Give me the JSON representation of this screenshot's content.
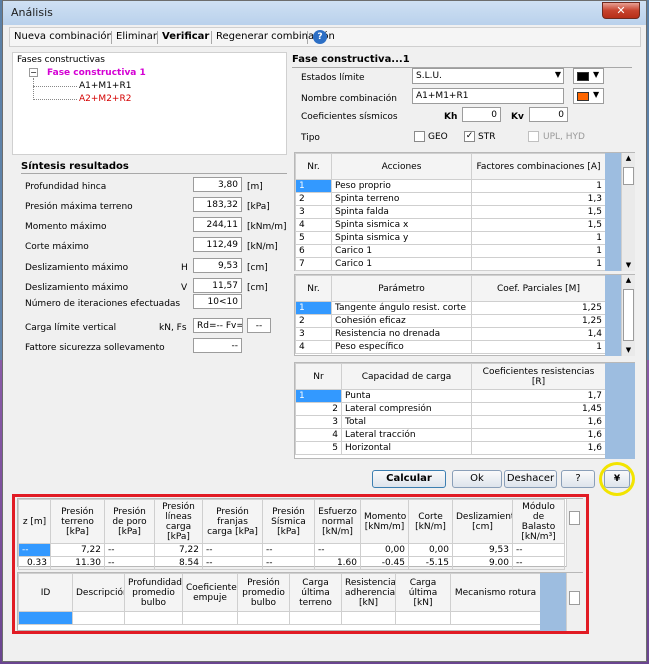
{
  "window": {
    "title": "Análisis",
    "close_label": "✕"
  },
  "toolbar": {
    "items": [
      "Nueva combinación",
      "Eliminar",
      "Verificar",
      "Regenerar combinación"
    ]
  },
  "tree": {
    "header": "Fases constructivas",
    "root": "Fase constructiva 1",
    "children": [
      {
        "label": "A1+M1+R1",
        "color": "#000000"
      },
      {
        "label": "A2+M2+R2",
        "color": "#d40000"
      }
    ]
  },
  "synth": {
    "title": "Síntesis resultados",
    "rows": [
      {
        "label": "Profundidad  hinca",
        "prefix": "",
        "value": "3,80",
        "unit": "[m]"
      },
      {
        "label": "Presión máxima terreno",
        "prefix": "",
        "value": "183,32",
        "unit": "[kPa]"
      },
      {
        "label": "Momento máximo",
        "prefix": "",
        "value": "244,11",
        "unit": "[kNm/m]"
      },
      {
        "label": "Corte máximo",
        "prefix": "",
        "value": "112,49",
        "unit": "[kN/m]"
      },
      {
        "label": "Deslizamiento máximo",
        "prefix": "H",
        "value": "9,53",
        "unit": "[cm]"
      },
      {
        "label": "Deslizamiento máximo",
        "prefix": "V",
        "value": "11,57",
        "unit": "[cm]"
      },
      {
        "label": "Número de iteraciones efectuadas",
        "prefix": "",
        "value": "10<10",
        "unit": ""
      },
      {
        "label": "Carga límite vertical",
        "prefix": "kN, Fs",
        "value": "Rd=-- Fv=--",
        "unit": "--"
      },
      {
        "label": "Fattore sicurezza sollevamento",
        "prefix": "",
        "value": "--",
        "unit": ""
      }
    ]
  },
  "phase": {
    "title": "Fase constructiva...1",
    "estados_label": "Estados límite",
    "estados_value": "S.L.U.",
    "nombre_label": "Nombre combinación",
    "nombre_value": "A1+M1+R1",
    "coef_label": "Coeficientes sísmicos",
    "kh_label": "Kh",
    "kh_value": "0",
    "kv_label": "Kv",
    "kv_value": "0",
    "tipo_label": "Tipo",
    "tipo_options": [
      {
        "label": "GEO",
        "checked": false,
        "disabled": false
      },
      {
        "label": "STR",
        "checked": true,
        "disabled": false
      },
      {
        "label": "UPL, HYD",
        "checked": false,
        "disabled": true
      }
    ],
    "color1": "#000000",
    "color2": "#ff6600"
  },
  "acciones": {
    "headers": [
      "Nr.",
      "Acciones",
      "Factores combinaciones [A]"
    ],
    "rows": [
      [
        "1",
        "Peso proprio",
        "1"
      ],
      [
        "2",
        "Spinta terreno",
        "1,3"
      ],
      [
        "3",
        "Spinta falda",
        "1,5"
      ],
      [
        "4",
        "Spinta sismica x",
        "1,5"
      ],
      [
        "5",
        "Spinta sismica y",
        "1"
      ],
      [
        "6",
        "Carico 1",
        "1"
      ],
      [
        "7",
        "Carico 1",
        "1"
      ]
    ]
  },
  "parametros": {
    "headers": [
      "Nr.",
      "Parámetro",
      "Coef. Parciales [M]"
    ],
    "rows": [
      [
        "1",
        "Tangente ángulo resist. corte",
        "1,25"
      ],
      [
        "2",
        "Cohesión eficaz",
        "1,25"
      ],
      [
        "3",
        "Resistencia no drenada",
        "1,4"
      ],
      [
        "4",
        "Peso específico",
        "1"
      ]
    ]
  },
  "capacidad": {
    "headers": [
      "Nr",
      "Capacidad de carga",
      "Coeficientes resistencias [R]"
    ],
    "rows": [
      [
        "1",
        "Punta",
        "1,7"
      ],
      [
        "2",
        "Lateral compresión",
        "1,45"
      ],
      [
        "3",
        "Total",
        "1,6"
      ],
      [
        "4",
        "Lateral tracción",
        "1,6"
      ],
      [
        "5",
        "Horizontal",
        "1,6"
      ]
    ]
  },
  "buttons": {
    "calcular": "Calcular",
    "ok": "Ok",
    "deshacer": "Deshacer",
    "help": "?",
    "expand": "¥"
  },
  "results": {
    "headers": [
      "z [m]",
      "Presión terreno [kPa]",
      "Presión de poro [kPa]",
      "Presión líneas carga [kPa]",
      "Presión franjas carga [kPa]",
      "Presión Sísmica [kPa]",
      "Esfuerzo normal [kN/m]",
      "Momento [kNm/m]",
      "Corte [kN/m]",
      "Deslizamiento [cm]",
      "Módulo de Balasto [kN/m³]"
    ],
    "rows": [
      [
        "--",
        "7,22",
        "--",
        "7,22",
        "--",
        "--",
        "--",
        "0,00",
        "0,00",
        "9,53",
        "--"
      ],
      [
        "0.33",
        "11.30",
        "--",
        "8.54",
        "--",
        "--",
        "1.60",
        "-0.45",
        "-5.15",
        "9.00",
        "--"
      ]
    ]
  },
  "bulbo": {
    "headers": [
      "ID",
      "Descripción",
      "Profundidad promedio bulbo",
      "Coeficiente empuje",
      "Presión promedio bulbo",
      "Carga última terreno",
      "Resistencia adherencia [kN]",
      "Carga última [kN]",
      "Mecanismo rotura"
    ]
  }
}
